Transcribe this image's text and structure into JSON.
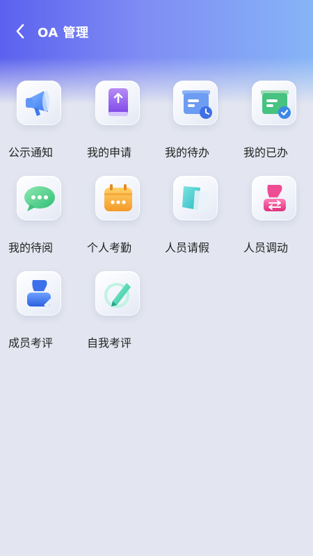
{
  "header": {
    "title": "OA 管理"
  },
  "items": [
    {
      "label": "公示通知",
      "icon": "megaphone-icon"
    },
    {
      "label": "我的申请",
      "icon": "upload-book-icon"
    },
    {
      "label": "我的待办",
      "icon": "pending-clock-icon"
    },
    {
      "label": "我的已办",
      "icon": "done-check-icon"
    },
    {
      "label": "我的待阅",
      "icon": "chat-bubble-icon"
    },
    {
      "label": "个人考勤",
      "icon": "calendar-icon"
    },
    {
      "label": "人员请假",
      "icon": "flag-icon"
    },
    {
      "label": "人员调动",
      "icon": "transfer-user-icon"
    },
    {
      "label": "成员考评",
      "icon": "user-edit-icon"
    },
    {
      "label": "自我考评",
      "icon": "pen-circle-icon"
    }
  ]
}
